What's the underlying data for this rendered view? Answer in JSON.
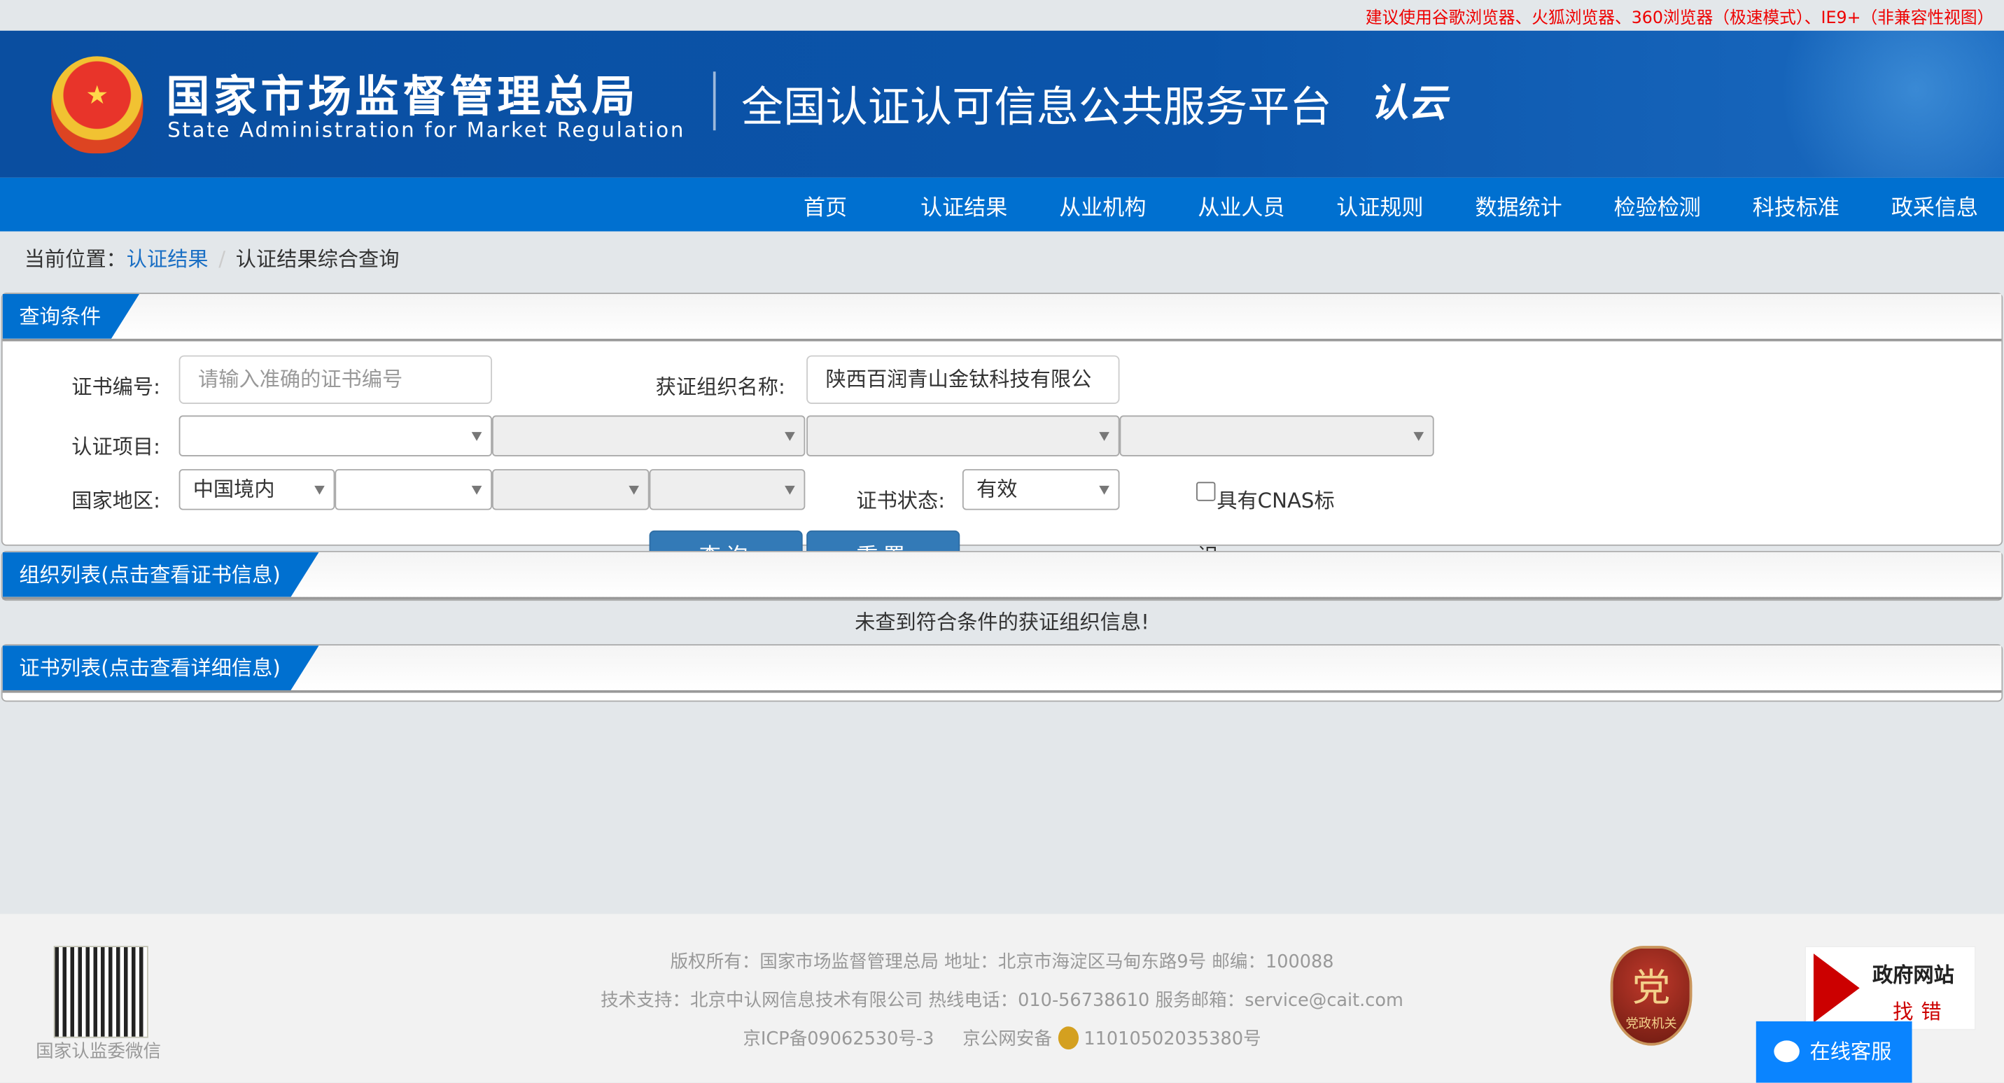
{
  "browser_tip": "建议使用谷歌浏览器、火狐浏览器、360浏览器（极速模式）、IE9+（非兼容性视图）",
  "header": {
    "org_cn": "国家市场监督管理总局",
    "org_en": "State Administration  for  Market Regulation",
    "platform": "全国认证认可信息公共服务平台",
    "logo_text": "认云"
  },
  "nav": [
    "首页",
    "认证结果",
    "从业机构",
    "从业人员",
    "认证规则",
    "数据统计",
    "检验检测",
    "科技标准",
    "政采信息"
  ],
  "breadcrumb": {
    "prefix": "当前位置：",
    "link": "认证结果",
    "sep": "/",
    "current": "认证结果综合查询"
  },
  "query": {
    "title": "查询条件",
    "cert_no_label": "证书编号:",
    "cert_no_placeholder": "请输入准确的证书编号",
    "org_label": "获证组织名称:",
    "org_value": "陕西百润青山金钛科技有限公",
    "project_label": "认证项目:",
    "region_label": "国家地区:",
    "region_value": "中国境内",
    "status_label": "证书状态:",
    "status_value": "有效",
    "cnas_label": "具有CNAS标",
    "cnas_label_wrap": "识",
    "search_button": "查询",
    "reset_button": "重置"
  },
  "org_list": {
    "title": "组织列表(点击查看证书信息)",
    "empty": "未查到符合条件的获证组织信息!"
  },
  "cert_list": {
    "title": "证书列表(点击查看详细信息)"
  },
  "footer": {
    "line1": "版权所有：国家市场监督管理总局    地址：北京市海淀区马甸东路9号    邮编：100088",
    "line2": "技术支持：北京中认网信息技术有限公司    热线电话：010-56738610    服务邮箱：service@cait.com",
    "icp": "京ICP备09062530号-3",
    "gongan": "京公网安备",
    "gongan_no": "11010502035380号",
    "qr_label": "国家认监委微信",
    "badge_text": "党政机关",
    "zhaocuo_1": "政府网站",
    "zhaocuo_2": "找错",
    "kefu": "在线客服"
  }
}
